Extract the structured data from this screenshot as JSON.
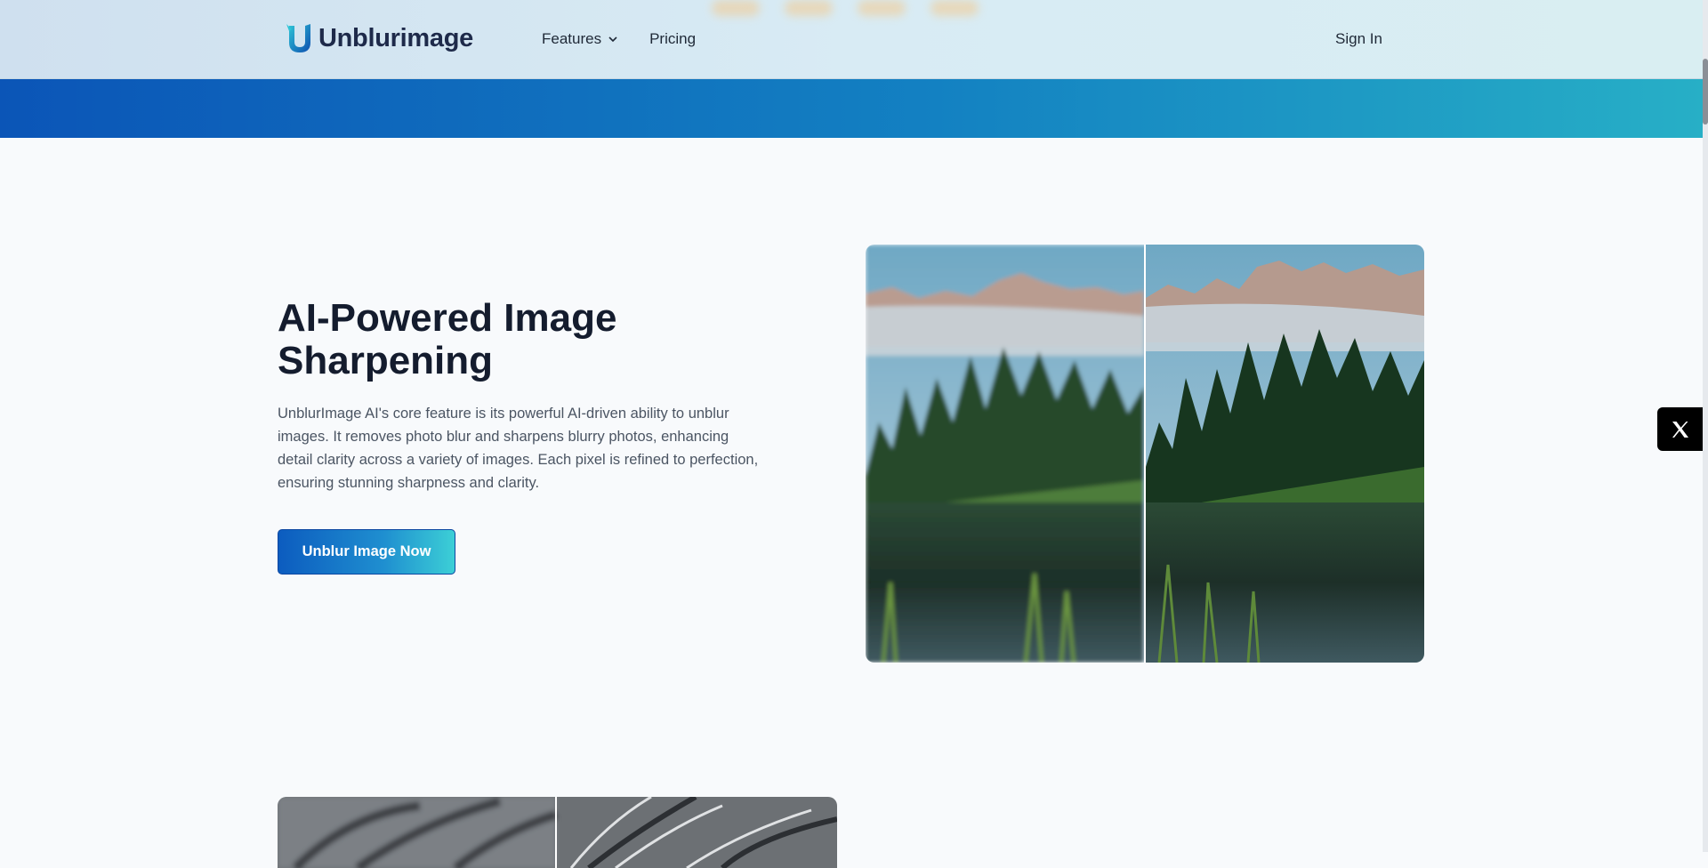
{
  "header": {
    "logo_text": "Unblurimage",
    "nav": [
      {
        "label": "Features",
        "has_dropdown": true
      },
      {
        "label": "Pricing",
        "has_dropdown": false
      }
    ],
    "sign_in": "Sign In"
  },
  "hero": {
    "title": "AI-Powered Image Sharpening",
    "description": "UnblurImage AI's core feature is its powerful AI-driven ability to unblur images. It removes photo blur and sharpens blurry photos, enhancing detail clarity across a variety of images. Each pixel is refined to perfection, ensuring stunning sharpness and clarity.",
    "cta_label": "Unblur Image Now"
  },
  "social": {
    "icon": "x-logo-icon"
  },
  "colors": {
    "brand_dark": "#1e2a4a",
    "band_start": "#0b55b7",
    "band_end": "#27afc6",
    "cta_start": "#0c5cbf",
    "cta_end": "#3ccfd6"
  }
}
